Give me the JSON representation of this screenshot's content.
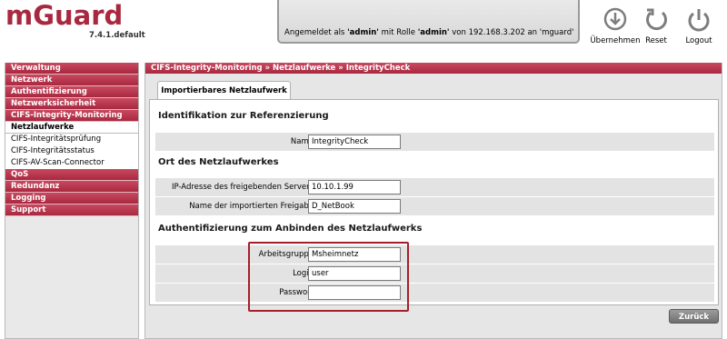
{
  "header": {
    "logo_text": "mGuard",
    "version": "7.4.1.default",
    "status": {
      "prefix": "Angemeldet als ",
      "user": "'admin'",
      "mid1": " mit Rolle ",
      "role": "'admin'",
      "mid2": " von 192.168.3.202 an 'mguard'"
    },
    "buttons": [
      {
        "label": "Übernehmen",
        "icon": "apply-icon"
      },
      {
        "label": "Reset",
        "icon": "reset-icon"
      },
      {
        "label": "Logout",
        "icon": "power-icon"
      }
    ],
    "brand_color": "#a8283f"
  },
  "sidebar": {
    "items": [
      {
        "label": "Verwaltung",
        "type": "main"
      },
      {
        "label": "Netzwerk",
        "type": "main"
      },
      {
        "label": "Authentifizierung",
        "type": "main"
      },
      {
        "label": "Netzwerksicherheit",
        "type": "main"
      },
      {
        "label": "CIFS-Integrity-Monitoring",
        "type": "main"
      },
      {
        "label": "Netzlaufwerke",
        "type": "sub-active"
      },
      {
        "label": "CIFS-Integritätsprüfung",
        "type": "sub"
      },
      {
        "label": "CIFS-Integritätsstatus",
        "type": "sub"
      },
      {
        "label": "CIFS-AV-Scan-Connector",
        "type": "sub"
      },
      {
        "label": "QoS",
        "type": "main"
      },
      {
        "label": "Redundanz",
        "type": "main"
      },
      {
        "label": "Logging",
        "type": "main"
      },
      {
        "label": "Support",
        "type": "main"
      }
    ]
  },
  "main": {
    "breadcrumb": "CIFS-Integrity-Monitoring » Netzlaufwerke » IntegrityCheck",
    "tab": "Importierbares Netzlaufwerk",
    "sections": {
      "identification": {
        "title": "Identifikation zur Referenzierung",
        "name_label": "Name",
        "name_value": "IntegrityCheck"
      },
      "location": {
        "title": "Ort des Netzlaufwerkes",
        "ip_label": "IP-Adresse des freigebenden Servers",
        "ip_value": "10.10.1.99",
        "share_label": "Name der importierten Freigabe",
        "share_value": "D_NetBook"
      },
      "auth": {
        "title": "Authentifizierung zum Anbinden des Netzlaufwerks",
        "workgroup_label": "Arbeitsgruppe",
        "workgroup_value": "Msheimnetz",
        "login_label": "Login",
        "login_value": "user",
        "password_label": "Passwort",
        "password_value": ""
      }
    },
    "back_button": "Zurück"
  }
}
